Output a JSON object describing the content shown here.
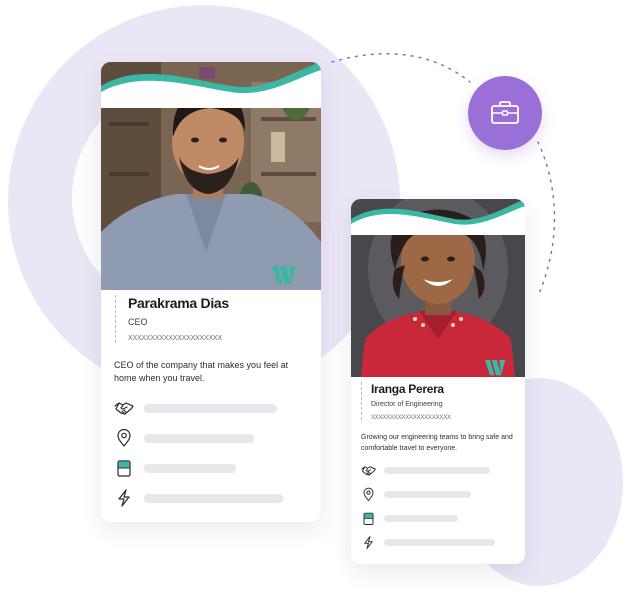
{
  "cards": [
    {
      "name": "Parakrama Dias",
      "role": "CEO",
      "code": "XXXXXXXXXXXXXXXXXXXXX",
      "description": "CEO of the company that makes you feel at home when you travel.",
      "rows": [
        {
          "icon": "handshake-icon",
          "fill": 0.86
        },
        {
          "icon": "location-pin-icon",
          "fill": 0.72
        },
        {
          "icon": "book-icon",
          "fill": 0.6
        },
        {
          "icon": "lightning-icon",
          "fill": 0.9
        }
      ]
    },
    {
      "name": "Iranga Perera",
      "role": "Director of Engineering",
      "code": "XXXXXXXXXXXXXXXXXXXXX",
      "description": "Growing our engineering teams to bring safe and comfortable travel to everyone.",
      "rows": [
        {
          "icon": "handshake-icon",
          "fill": 0.8
        },
        {
          "icon": "location-pin-icon",
          "fill": 0.66
        },
        {
          "icon": "book-icon",
          "fill": 0.56
        },
        {
          "icon": "lightning-icon",
          "fill": 0.84
        }
      ]
    }
  ],
  "colors": {
    "accent_teal": "#3bb8a4",
    "accent_purple": "#9a6fd8",
    "background_blob": "#ebe6f6",
    "placeholder_bar": "#e7e7ec"
  },
  "badge": {
    "icon": "briefcase-icon"
  },
  "logo": {
    "icon": "vw-logo-icon"
  }
}
